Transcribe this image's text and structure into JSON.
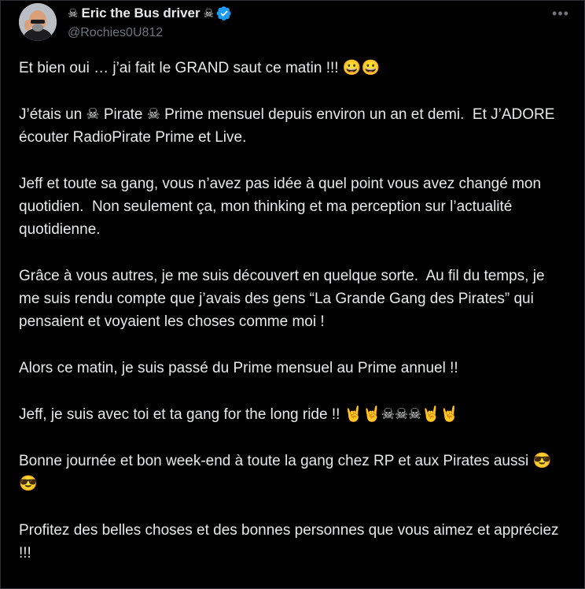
{
  "author": {
    "name": "Eric the Bus driver",
    "handle": "@Rochies0U812",
    "name_prefix_emoji": "☠",
    "name_suffix_emoji": "☠",
    "verified": true
  },
  "more_icon": "•••",
  "colors": {
    "background": "#000000",
    "text": "#e7e9ea",
    "secondary": "#71767b",
    "verified_blue": "#1d9bf0"
  },
  "tweet": {
    "paragraphs": [
      "Et bien oui … j’ai fait le GRAND saut ce matin !!! 😀😀",
      "J’étais un ☠ Pirate ☠ Prime mensuel depuis environ un an et demi.  Et J’ADORE écouter RadioPirate Prime et Live.",
      "Jeff et toute sa gang, vous n’avez pas idée à quel point vous avez changé mon quotidien.  Non seulement ça, mon thinking et ma perception sur l’actualité quotidienne.",
      "Grâce à vous autres, je me suis découvert en quelque sorte.  Au fil du temps, je me suis rendu compte que j’avais des gens “La Grande Gang des Pirates” qui pensaient et voyaient les choses comme moi !",
      "Alors ce matin, je suis passé du Prime mensuel au Prime annuel !!",
      "Jeff, je suis avec toi et ta gang for the long ride !! 🤘🤘☠☠☠🤘🤘",
      "Bonne journée et bon week-end à toute la gang chez RP et aux Pirates aussi 😎😎",
      "Profitez des belles choses et des bonnes personnes que vous aimez et appréciez !!!"
    ]
  }
}
